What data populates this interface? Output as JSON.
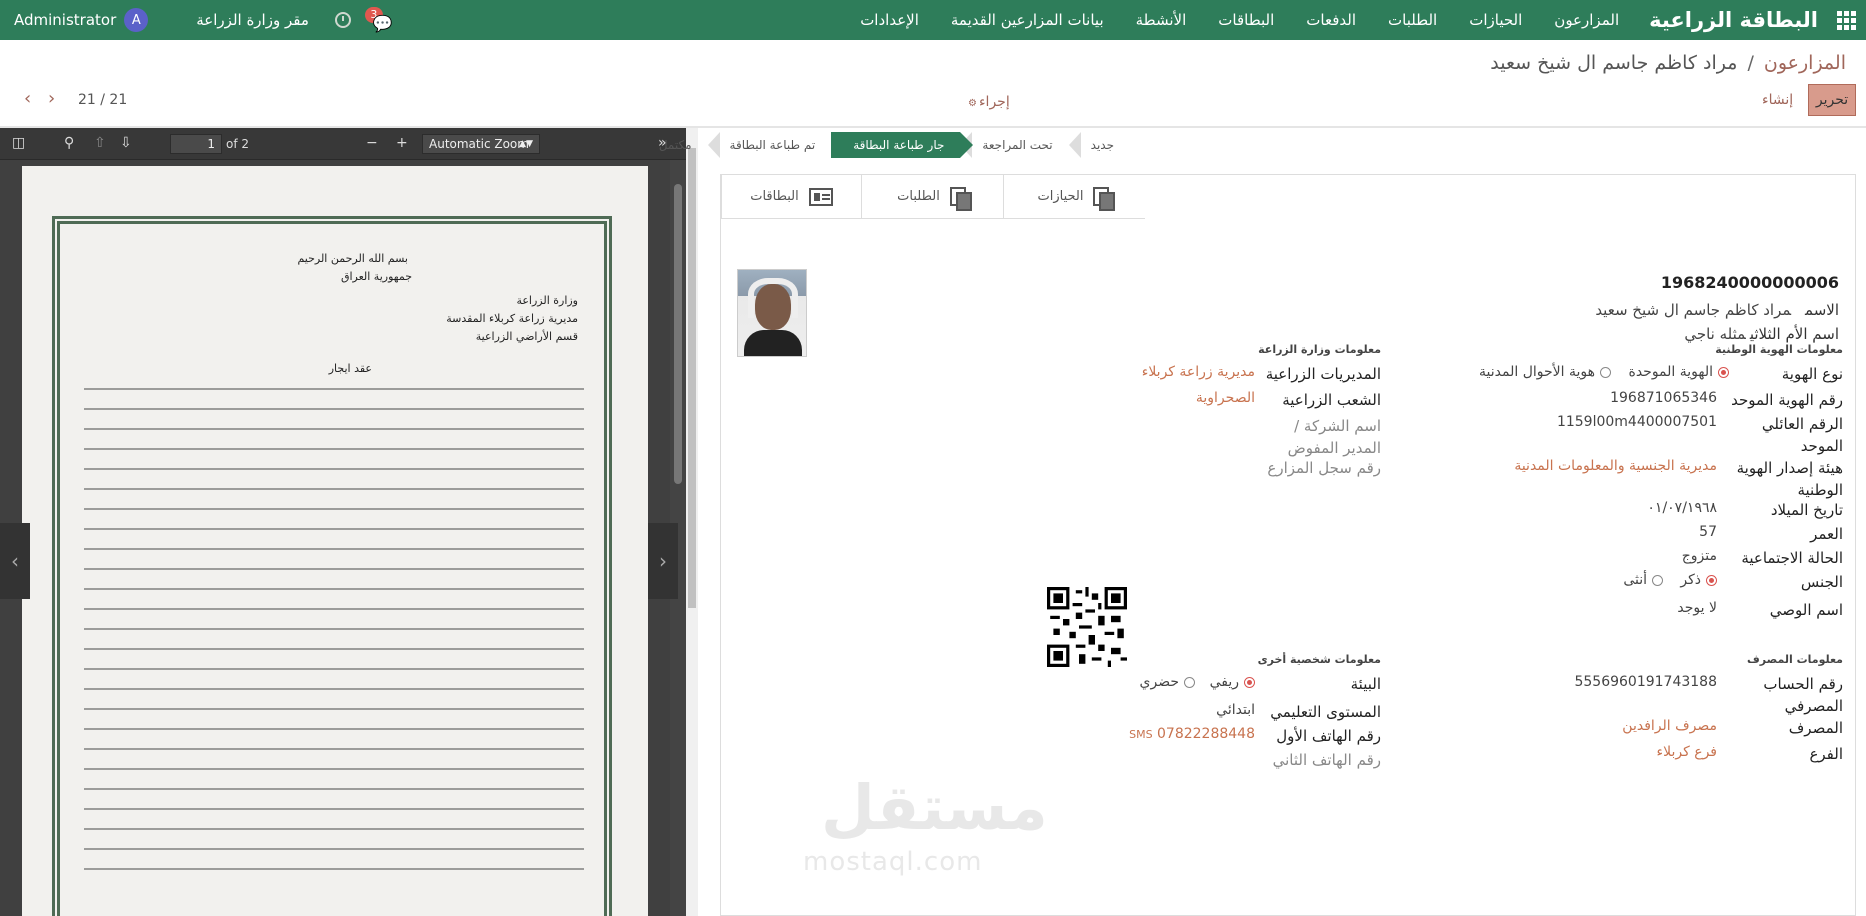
{
  "navbar": {
    "brand": "البطاقة الزراعية",
    "menu": [
      "المزارعون",
      "الحيازات",
      "الطلبات",
      "الدفعات",
      "البطاقات",
      "الأنشطة",
      "بيانات المزارعين القديمة",
      "الإعدادات"
    ],
    "user": "Administrator",
    "user_initial": "A",
    "company": "مقر وزارة الزراعة",
    "chat_badge": "3",
    "accent_color": "#2e7d5a"
  },
  "breadcrumb": {
    "parent": "المزارعون",
    "separator": "/",
    "current": "مراد كاظم جاسم ال شيخ سعيد"
  },
  "controls": {
    "edit": "تحرير",
    "create": "إنشاء",
    "action": "إجراء",
    "pager": "21 / 21"
  },
  "pdf": {
    "page": "1",
    "of": "of 2",
    "zoom": "Automatic Zoom",
    "doc_lines": [
      "بسم الله الرحمن الرحيم",
      "جمهورية العراق",
      "وزارة الزراعة",
      "مديرية زراعة كربلاء المقدسة",
      "قسم الأراضي الزراعية",
      "عقد ايجار"
    ]
  },
  "status": [
    "جديد",
    "تحت المراجعة",
    "جار طباعة البطاقة",
    "تم طباعة البطاقة",
    "مكتمل"
  ],
  "status_active": 2,
  "smart_buttons": {
    "holdings": "الحيازات",
    "requests": "الطلبات",
    "cards": "البطاقات"
  },
  "farmer": {
    "id_number": "1968240000000006",
    "name_label": "الاسم",
    "name": "مراد كاظم جاسم ال شيخ سعيد",
    "mother_label": "اسم الأم الثلاثي",
    "mother": "مثله ناجي"
  },
  "national_id": {
    "title": "معلومات الهوية الوطنية",
    "type_label": "نوع الهوية",
    "type_opt1": "الهوية الموحدة",
    "type_opt2": "هوية الأحوال المدنية",
    "unified_label": "رقم الهوية الموحد",
    "unified": "196871065346",
    "family_label": "الرقم العائلي الموحد",
    "family": "1159l00m4400007501",
    "issuer_label": "هيئة إصدار الهوية الوطنية",
    "issuer": "مديرية الجنسية والمعلومات المدنية",
    "dob_label": "تاريخ الميلاد",
    "dob": "٠١/٠٧/١٩٦٨",
    "age_label": "العمر",
    "age": "57",
    "marital_label": "الحالة الاجتماعية",
    "marital": "متزوج",
    "gender_label": "الجنس",
    "gender_m": "ذكر",
    "gender_f": "أنثى",
    "guardian_label": "اسم الوصي",
    "guardian": "لا يوجد"
  },
  "ministry": {
    "title": "معلومات وزارة الزراعة",
    "directorate_label": "المديريات الزراعية",
    "directorate": "مديرية زراعة كربلاء",
    "division_label": "الشعب الزراعية",
    "division": "الصحراوية",
    "company_label": "اسم الشركة / المدير المفوض",
    "registry_label": "رقم سجل المزارع"
  },
  "bank": {
    "title": "معلومات المصرف",
    "account_label": "رقم الحساب المصرفي",
    "account": "5556960191743188",
    "bank_label": "المصرف",
    "bank": "مصرف الرافدين",
    "branch_label": "الفرع",
    "branch": "فرع كربلاء"
  },
  "personal": {
    "title": "معلومات شخصية أخرى",
    "env_label": "البيئة",
    "env_rural": "ريفي",
    "env_urban": "حضري",
    "edu_label": "المستوى التعليمي",
    "edu": "ابتدائي",
    "phone1_label": "رقم الهاتف الأول",
    "phone1": "07822288448",
    "sms": "SMS",
    "phone2_label": "رقم الهاتف الثاني"
  },
  "watermark": {
    "arabic": "مستقل",
    "latin": "mostaql.com"
  }
}
